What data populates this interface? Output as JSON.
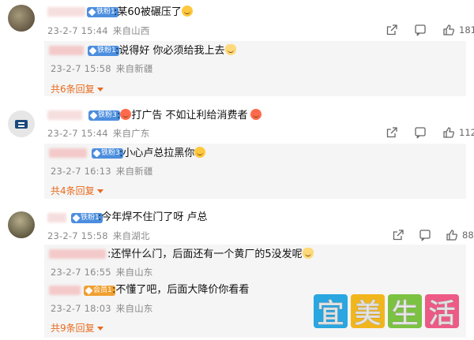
{
  "comments": [
    {
      "badge": "铁粉1",
      "text": ":某60被碾压了",
      "time": "23-2-7 15:44",
      "location": "来自山西",
      "likes": "181",
      "reply": {
        "badge": "铁粉1",
        "text": ":说得好 你必须给我上去",
        "time": "23-2-7 15:58",
        "location": "来自新疆"
      },
      "more": "共6条回复"
    },
    {
      "badge": "铁粉3",
      "text": "打广告 不如让利给消费者",
      "time": "23-2-7 15:44",
      "location": "来自广东",
      "likes": "112",
      "reply": {
        "badge": "铁粉3",
        "text": ":小心卢总拉黑你",
        "time": "23-2-7 16:13",
        "location": "来自新疆"
      },
      "more": "共4条回复"
    },
    {
      "badge": "铁粉1",
      "text": ":今年焊不住门了呀 卢总",
      "time": "23-2-7 15:58",
      "location": "来自湖北",
      "likes": "88",
      "replies": [
        {
          "text": ":还悍什么门，后面还有一个黄厂的5没发呢",
          "time": "23-2-7 16:55",
          "location": "来自山东"
        },
        {
          "badge": "会员1",
          "text": ":不懂了吧，后面大降价你看看",
          "time": "23-2-7 18:03",
          "location": "来自山东"
        }
      ],
      "more": "共9条回复"
    }
  ],
  "watermark": [
    "宜",
    "美",
    "生",
    "活"
  ],
  "icon_names": [
    "share-icon",
    "comment-icon",
    "like-icon"
  ]
}
